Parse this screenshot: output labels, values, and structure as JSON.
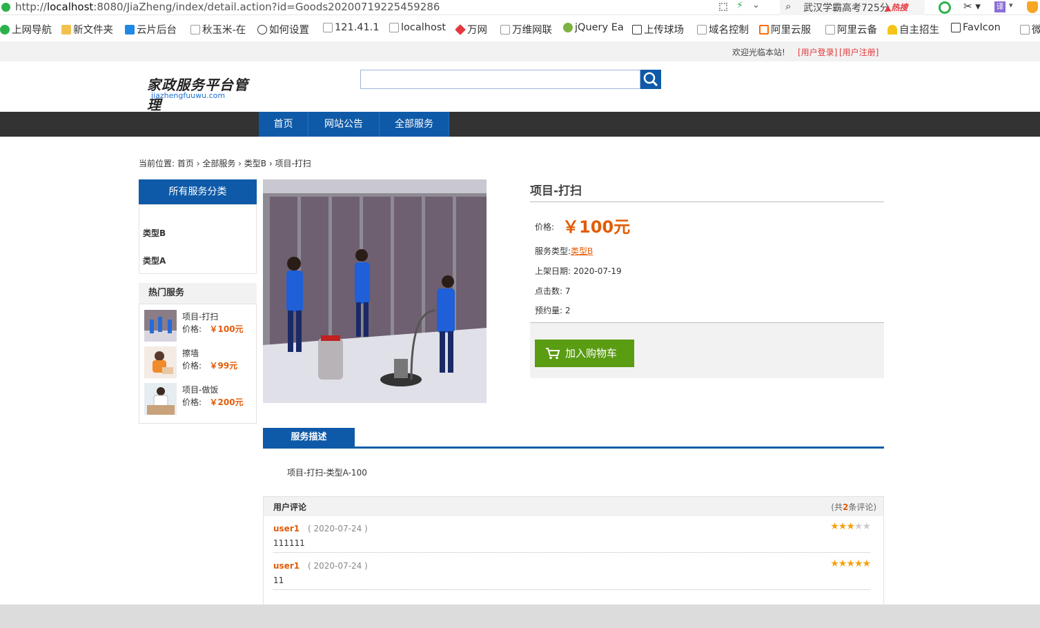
{
  "browser": {
    "url_prefix": "http://",
    "url_host": "localhost",
    "url_rest": ":8080/JiaZheng/index/detail.action?id=Goods20200719225459286",
    "search_text": "武汉学霸高考725分",
    "hot_badge": "热搜",
    "translate_label": "译",
    "bookmarks": [
      "上网导航",
      "新文件夹",
      "云片后台",
      "秋玉米-在",
      "如何设置",
      "121.41.1",
      "localhost",
      "万网",
      "万维网联",
      "jQuery Ea",
      "上传球场",
      "域名控制",
      "阿里云服",
      "阿里云备",
      "自主招生",
      "FavIcon",
      "微"
    ]
  },
  "topbar": {
    "welcome": "欢迎光临本站!",
    "login": "[用户登录]",
    "register": "[用户注册]"
  },
  "header": {
    "logo_text": "家政服务平台管理",
    "logo_domain": "jiazhengfuuwu.com",
    "search_placeholder": ""
  },
  "nav": [
    "首页",
    "网站公告",
    "全部服务"
  ],
  "breadcrumb": {
    "prefix": "当前位置:",
    "items": [
      "首页",
      "全部服务",
      "类型B",
      "项目-打扫"
    ]
  },
  "sidebar": {
    "categories_title": "所有服务分类",
    "categories": [
      "类型B",
      "类型A"
    ],
    "hot_title": "热门服务",
    "price_label": "价格:",
    "hot": [
      {
        "name": "项目-打扫",
        "price": "￥100元"
      },
      {
        "name": "擦墙",
        "price": "￥99元"
      },
      {
        "name": "项目-做饭",
        "price": "￥200元"
      }
    ]
  },
  "product": {
    "title": "项目-打扫",
    "price_label": "价格:",
    "price": "￥100元",
    "type_label": "服务类型:",
    "type_value": "类型B",
    "date_label": "上架日期:",
    "date_value": "2020-07-19",
    "clicks_label": "点击数:",
    "clicks_value": "7",
    "booking_label": "预约量:",
    "booking_value": "2",
    "cart_button": "加入购物车"
  },
  "description": {
    "tab": "服务描述",
    "text": "项目-打扫-类型A-100"
  },
  "reviews": {
    "title": "用户评论",
    "count_prefix": "(共",
    "count": "2",
    "count_suffix": "条评论)",
    "items": [
      {
        "user": "user1",
        "date": "( 2020-07-24 )",
        "text": "111111",
        "rating": 3
      },
      {
        "user": "user1",
        "date": "( 2020-07-24 )",
        "text": "11",
        "rating": 5
      }
    ]
  }
}
